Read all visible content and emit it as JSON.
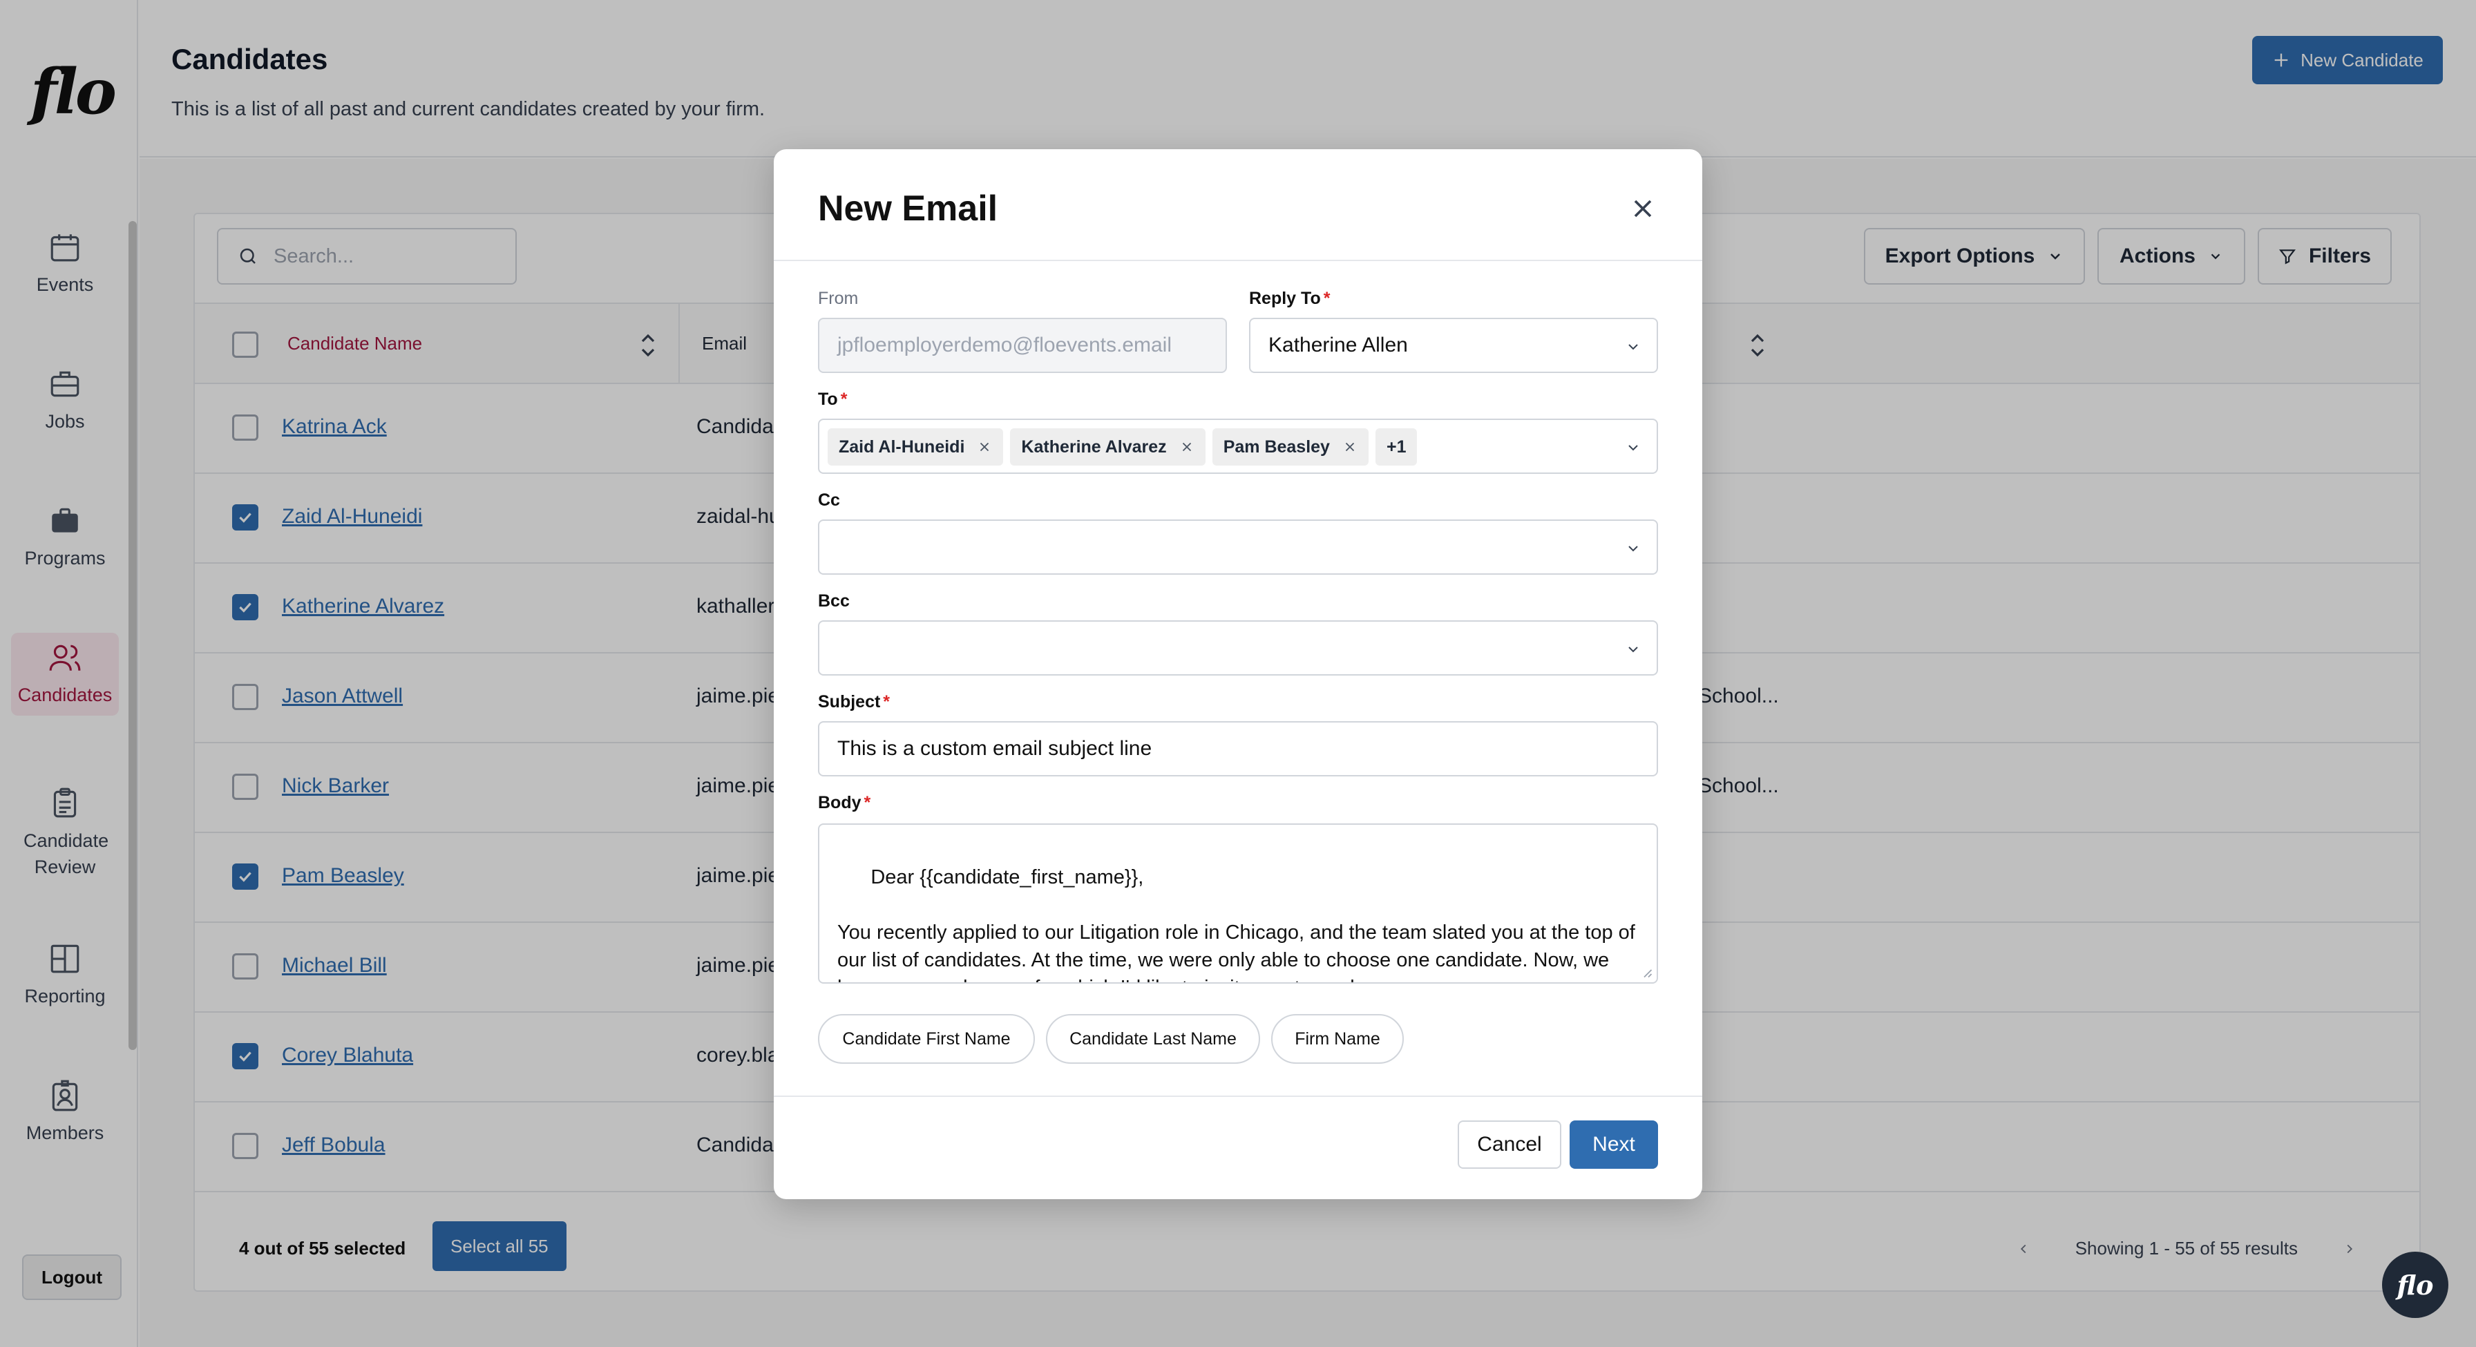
{
  "app": {
    "logo": "flo",
    "nav": [
      {
        "label": "Events",
        "icon": "calendar-icon"
      },
      {
        "label": "Jobs",
        "icon": "briefcase-icon"
      },
      {
        "label": "Programs",
        "icon": "portfolio-icon"
      },
      {
        "label": "Candidates",
        "icon": "users-icon",
        "active": true
      },
      {
        "label": "Candidate Review",
        "icon": "clipboard-icon"
      },
      {
        "label": "Reporting",
        "icon": "layout-icon"
      },
      {
        "label": "Members",
        "icon": "badge-icon"
      }
    ],
    "logout_label": "Logout",
    "chat_label": "flo",
    "accent_color": "#a3163f",
    "primary_color": "#2f6db0"
  },
  "header": {
    "title": "Candidates",
    "subtitle": "This is a list of all past and current candidates created by your firm.",
    "new_candidate_label": "New Candidate"
  },
  "toolbar": {
    "search_placeholder": "Search...",
    "export_label": "Export Options",
    "actions_label": "Actions",
    "filters_label": "Filters"
  },
  "table": {
    "columns": [
      "Candidate Name",
      "Email"
    ],
    "rows": [
      {
        "name": "Katrina Ack",
        "email": "Candida",
        "extra": "",
        "checked": false
      },
      {
        "name": "Zaid Al-Huneidi",
        "email": "zaidal-hu",
        "extra": "",
        "checked": true
      },
      {
        "name": "Katherine Alvarez",
        "email": "kathaller",
        "extra": "",
        "checked": true
      },
      {
        "name": "Jason Attwell",
        "email": "jaime.pie",
        "extra": "School...",
        "checked": false
      },
      {
        "name": "Nick Barker",
        "email": "jaime.pie",
        "extra": "School...",
        "checked": false
      },
      {
        "name": "Pam Beasley",
        "email": "jaime.pie",
        "extra": "",
        "checked": true
      },
      {
        "name": "Michael Bill",
        "email": "jaime.pie",
        "extra": "",
        "checked": false
      },
      {
        "name": "Corey Blahuta",
        "email": "corey.bla",
        "extra": "",
        "checked": true
      },
      {
        "name": "Jeff Bobula",
        "email": "Candida",
        "extra": "",
        "checked": false
      }
    ],
    "selected_text": "4 out of 55 selected",
    "select_all_label": "Select all 55",
    "pagination_text": "Showing 1 - 55 of 55 results"
  },
  "modal": {
    "title": "New Email",
    "from_label": "From",
    "from_value": "jpfloemployerdemo@floevents.email",
    "reply_to_label": "Reply To",
    "reply_to_value": "Katherine Allen",
    "to_label": "To",
    "to_chips": [
      "Zaid Al-Huneidi",
      "Katherine Alvarez",
      "Pam Beasley"
    ],
    "to_more": "+1",
    "cc_label": "Cc",
    "bcc_label": "Bcc",
    "subject_label": "Subject",
    "subject_value": "This is a custom email subject line",
    "body_label": "Body",
    "body_value": "Dear {{candidate_first_name}},\n\nYou recently applied to our Litigation role in Chicago, and the team slated you at the top of our list of candidates. At the time, we were only able to choose one candidate. Now, we have a new role open for which I'd like to invite you to apply.",
    "variables": [
      "Candidate First Name",
      "Candidate Last Name",
      "Firm Name"
    ],
    "cancel_label": "Cancel",
    "next_label": "Next"
  }
}
